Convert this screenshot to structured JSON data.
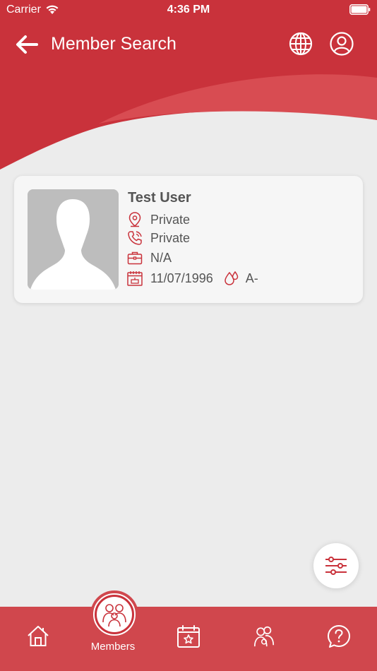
{
  "status_bar": {
    "carrier": "Carrier",
    "time": "4:36 PM"
  },
  "nav": {
    "title": "Member Search"
  },
  "member_card": {
    "name": "Test User",
    "address": "Private",
    "phone": "Private",
    "occupation": "N/A",
    "birth_date": "11/07/1996",
    "blood_group": "A-"
  },
  "tabbar": {
    "members_label": "Members",
    "items": [
      "home-icon",
      "members-icon",
      "calendar-star-icon",
      "family-icon",
      "help-icon"
    ]
  },
  "colors": {
    "brand_red": "#c9323b",
    "tab_red": "#d0474d",
    "background": "#ececec",
    "card": "#f6f6f6"
  }
}
